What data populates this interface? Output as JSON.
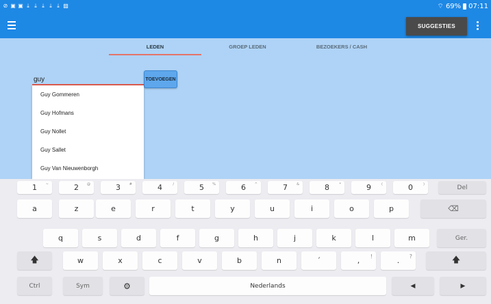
{
  "status_bar": {
    "signal_icon": "wifi-icon",
    "battery_text": "69%",
    "time": "07:11"
  },
  "app_bar": {
    "menu_icon": "hamburger-menu-icon",
    "suggestions_label": "SUGGESTIES",
    "overflow_icon": "overflow-menu-icon"
  },
  "tabs": [
    {
      "label": "LEDEN",
      "active": true
    },
    {
      "label": "GROEP LEDEN",
      "active": false
    },
    {
      "label": "BEZOEKERS / CASH",
      "active": false
    }
  ],
  "search": {
    "value": "guy",
    "add_label": "TOEVOEGEN"
  },
  "suggestions": [
    "Guy Gommeren",
    "Guy Hofmans",
    "Guy Nollet",
    "Guy Sallet",
    "Guy Van Nieuwenborgh"
  ],
  "keyboard": {
    "numbers": [
      {
        "main": "1",
        "alt": "~"
      },
      {
        "main": "2",
        "alt": "@"
      },
      {
        "main": "3",
        "alt": "#"
      },
      {
        "main": "4",
        "alt": "/"
      },
      {
        "main": "5",
        "alt": "%"
      },
      {
        "main": "6",
        "alt": "^"
      },
      {
        "main": "7",
        "alt": "&"
      },
      {
        "main": "8",
        "alt": "*"
      },
      {
        "main": "9",
        "alt": "("
      },
      {
        "main": "0",
        "alt": ")"
      }
    ],
    "del_label": "Del",
    "row1": [
      "a",
      "z",
      "e",
      "r",
      "t",
      "y",
      "u",
      "i",
      "o",
      "p"
    ],
    "row2": [
      "q",
      "s",
      "d",
      "f",
      "g",
      "h",
      "j",
      "k",
      "l",
      "m"
    ],
    "enter_label": "Ger.",
    "row3": [
      "w",
      "x",
      "c",
      "v",
      "b",
      "n",
      "´",
      ",",
      "."
    ],
    "row3_alt": [
      "",
      "",
      "",
      "",
      "",
      "",
      "",
      "!",
      "?"
    ],
    "ctrl_label": "Ctrl",
    "sym_label": "Sym",
    "space_label": "Nederlands",
    "backspace_icon": "backspace-icon",
    "shift_icon": "shift-arrow-icon",
    "settings_icon": "gear-icon",
    "left_arrow_icon": "left-arrow-icon",
    "right_arrow_icon": "right-arrow-icon"
  }
}
